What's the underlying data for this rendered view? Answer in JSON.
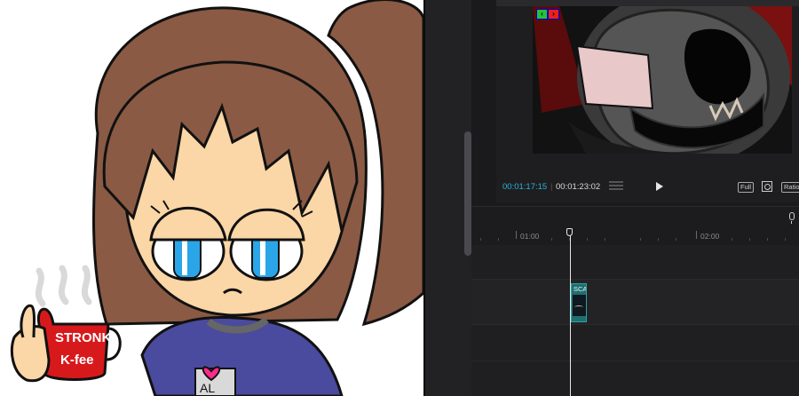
{
  "overlay": {
    "mug_text_line1": "STRONK",
    "mug_text_line2": "K-fee",
    "shirt_text": "AL"
  },
  "preview": {
    "nav_back_icon": "chevron-left",
    "nav_forward_icon": "chevron-right",
    "current_time": "00:01:17:15",
    "total_time": "00:01:23:02",
    "full_label": "Full",
    "ratio_label": "Ratio",
    "play_icon": "play-icon",
    "zoom_icon": "zoom-icon"
  },
  "timeline": {
    "ruler_labels": [
      "01:00",
      "02:00"
    ],
    "clip_label": "SCA",
    "mic_icon": "microphone-icon"
  },
  "colors": {
    "accent_timecode": "#2bb3d9",
    "clip": "#1f6f6f",
    "mug": "#d8191c",
    "hair": "#8a5a44"
  }
}
